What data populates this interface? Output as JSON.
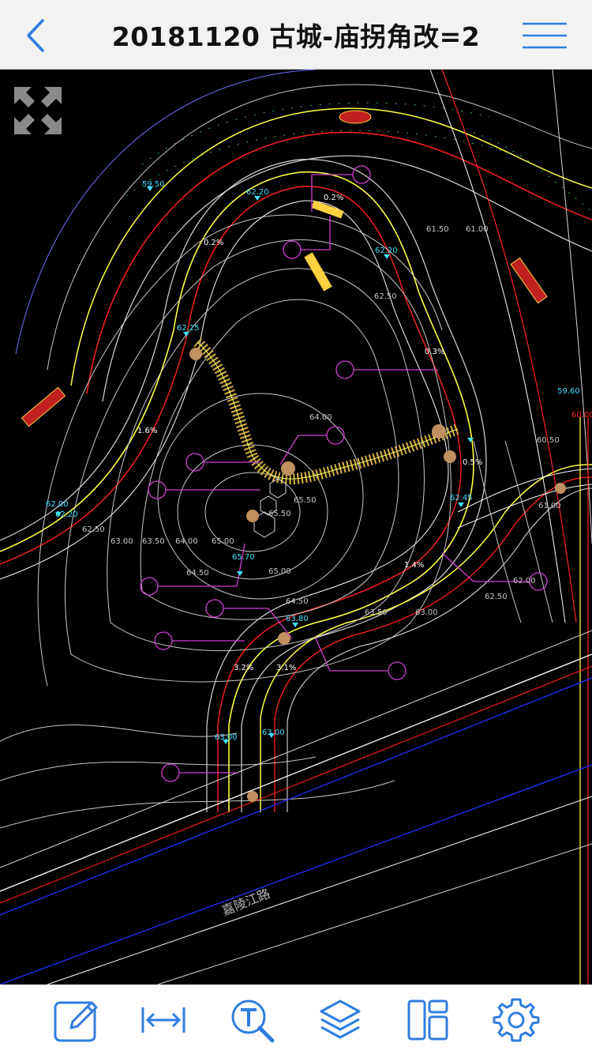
{
  "header": {
    "title": "20181120 古城-庙拐角改=2",
    "back_icon": "chevron-left-icon",
    "menu_icon": "hamburger-menu-icon"
  },
  "canvas": {
    "fullscreen_icon": "expand-arrows-icon",
    "elevations": [
      "59.50",
      "62.20",
      "62.20",
      "62.25",
      "62.00",
      "62.20",
      "62.50",
      "63.00",
      "63.50",
      "64.00",
      "64.00",
      "64.50",
      "65.00",
      "65.50",
      "65.70",
      "65.50",
      "65.00",
      "64.50",
      "63.80",
      "63.00",
      "63.00",
      "62.45",
      "62.50",
      "63.00",
      "63.50",
      "62.50",
      "61.50",
      "61.00",
      "60.50",
      "59.60",
      "60.00",
      "61.00",
      "62.00"
    ],
    "slopes": [
      "0.2%",
      "0.2%",
      "0.3%",
      "1.6%",
      "0.5%",
      "1.4%",
      "3.2%",
      "3.1%"
    ],
    "street_label": "嘉陵江路",
    "colors": {
      "background": "#000000",
      "contour": "#c8c8c8",
      "road_red": "#ff2020",
      "road_yellow": "#ffff40",
      "callout": "#d040d0",
      "annotation": "#40e0ff",
      "boundary": "#2030ff"
    }
  },
  "toolbar": {
    "items": [
      {
        "name": "edit-tool",
        "icon": "pencil-icon"
      },
      {
        "name": "measure-tool",
        "icon": "measure-arrows-icon"
      },
      {
        "name": "text-search-tool",
        "icon": "text-search-icon"
      },
      {
        "name": "layers-tool",
        "icon": "layers-icon"
      },
      {
        "name": "layout-tool",
        "icon": "layout-icon"
      },
      {
        "name": "settings-tool",
        "icon": "gear-icon"
      }
    ],
    "accent": "#2f7de1"
  }
}
